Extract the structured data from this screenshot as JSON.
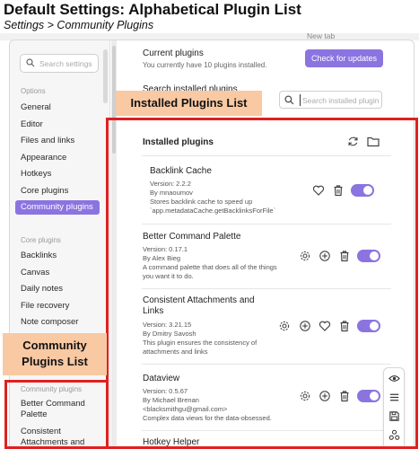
{
  "header": {
    "title": "Default Settings: Alphabetical Plugin List",
    "subtitle": "Settings > Community Plugins"
  },
  "background": {
    "new_tab": "New tab"
  },
  "sidebar": {
    "search_placeholder": "Search settings",
    "options_heading": "Options",
    "options_items": [
      "General",
      "Editor",
      "Files and links",
      "Appearance",
      "Hotkeys",
      "Core plugins",
      "Community plugins"
    ],
    "active_item": "Community plugins",
    "core_heading": "Core plugins",
    "core_items": [
      "Backlinks",
      "Canvas",
      "Daily notes",
      "File recovery",
      "Note composer"
    ],
    "community_heading": "Community plugins",
    "community_items": [
      "Better Command Palette",
      "Consistent Attachments and"
    ]
  },
  "main": {
    "current_title": "Current plugins",
    "current_subtitle": "You currently have 10 plugins installed.",
    "check_button": "Check for updates",
    "search_label": "Search installed plugins",
    "search_placeholder": "Search installed plugins",
    "installed_title": "Installed plugins",
    "plugins": [
      {
        "name": "Backlink Cache",
        "version": "Version: 2.2.2",
        "author": "By mnaoumov",
        "description": [
          "Stores backlink cache to speed up",
          "`app.metadataCache.getBacklinksForFile`"
        ],
        "enabled": true
      },
      {
        "name": "Better Command Palette",
        "version": "Version: 0.17.1",
        "author": "By Alex Bieg",
        "description": [
          "A command palette that does all of the things",
          "you want it to do."
        ],
        "enabled": true
      },
      {
        "name": "Consistent Attachments and Links",
        "version": "Version: 3.21.15",
        "author": "By Dmitry Savosh",
        "description": [
          "This plugin ensures the consistency of",
          "attachments and links"
        ],
        "enabled": true
      },
      {
        "name": "Dataview",
        "version": "Version: 0.5.67",
        "author": "By Michael Brenan",
        "description": [
          "<blacksmithgu@gmail.com>",
          "Complex data views for the data-obsessed."
        ],
        "enabled": true
      },
      {
        "name": "Hotkey Helper",
        "version": "",
        "author": "",
        "description": [],
        "enabled": true
      }
    ]
  },
  "annotations": {
    "installed_label": "Installed Plugins List",
    "community_label": "Community Plugins List"
  },
  "colors": {
    "accent": "#8b74e0",
    "annotation_fill": "#f8c9a3",
    "annotation_border": "#e02020"
  },
  "icons": [
    "search-icon",
    "refresh-icon",
    "folder-icon",
    "heart-icon",
    "trash-icon",
    "gear-icon",
    "plus-circle-icon",
    "eye-icon",
    "menu-icon",
    "save-icon",
    "share-icon"
  ]
}
